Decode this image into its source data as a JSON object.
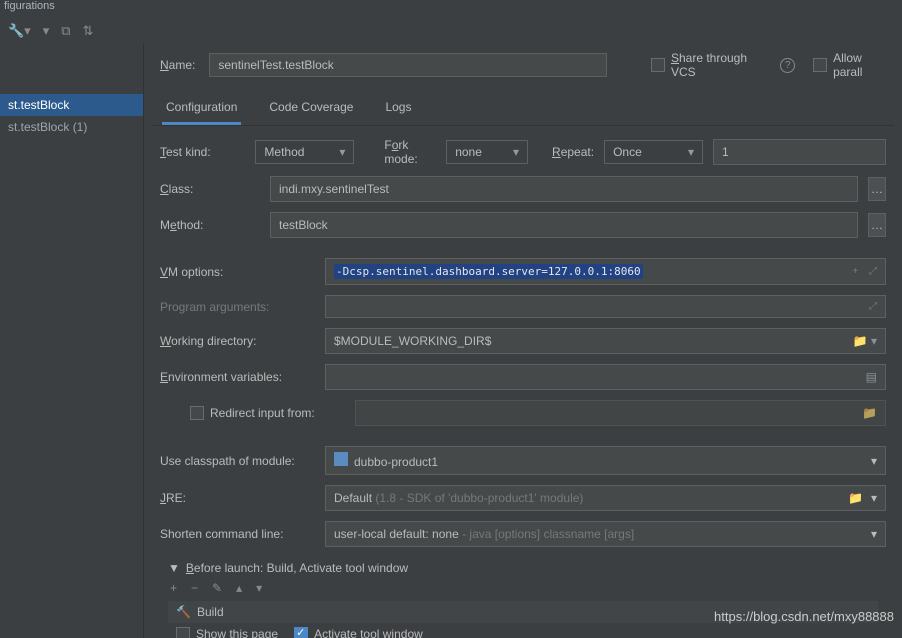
{
  "window_title": "figurations",
  "sidebar": {
    "items": [
      {
        "label": "st.testBlock",
        "selected": true
      },
      {
        "label": "st.testBlock (1)",
        "selected": false
      }
    ]
  },
  "name": {
    "label": "Name:",
    "value": "sentinelTest.testBlock"
  },
  "share_vcs": {
    "label": "Share through VCS",
    "checked": false
  },
  "allow_parallel": {
    "label": "Allow parall",
    "checked": false
  },
  "tabs": [
    {
      "label": "Configuration",
      "active": true
    },
    {
      "label": "Code Coverage",
      "active": false
    },
    {
      "label": "Logs",
      "active": false
    }
  ],
  "form": {
    "test_kind": {
      "label": "Test kind:",
      "value": "Method"
    },
    "fork_mode": {
      "label": "Fork mode:",
      "value": "none"
    },
    "repeat": {
      "label": "Repeat:",
      "value": "Once"
    },
    "repeat_count": "1",
    "class": {
      "label": "Class:",
      "value": "indi.mxy.sentinelTest"
    },
    "method": {
      "label": "Method:",
      "value": "testBlock"
    },
    "vm_options": {
      "label": "VM options:",
      "value": "-Dcsp.sentinel.dashboard.server=127.0.0.1:8060"
    },
    "program_args": {
      "label": "Program arguments:",
      "value": ""
    },
    "working_dir": {
      "label": "Working directory:",
      "value": "$MODULE_WORKING_DIR$"
    },
    "env_vars": {
      "label": "Environment variables:",
      "value": ""
    },
    "redirect_input": {
      "label": "Redirect input from:",
      "checked": false,
      "value": ""
    },
    "classpath": {
      "label": "Use classpath of module:",
      "value": "dubbo-product1"
    },
    "jre": {
      "label": "JRE:",
      "value": "Default",
      "hint": "(1.8 - SDK of 'dubbo-product1' module)"
    },
    "shorten": {
      "label": "Shorten command line:",
      "value": "user-local default: none",
      "hint": "- java [options] classname [args]"
    }
  },
  "before_launch": {
    "header": "Before launch: Build, Activate tool window",
    "build_label": "Build",
    "show_page": {
      "label": "Show this page",
      "checked": false
    },
    "activate_tool": {
      "label": "Activate tool window",
      "checked": true
    }
  },
  "watermark": "https://blog.csdn.net/mxy88888"
}
